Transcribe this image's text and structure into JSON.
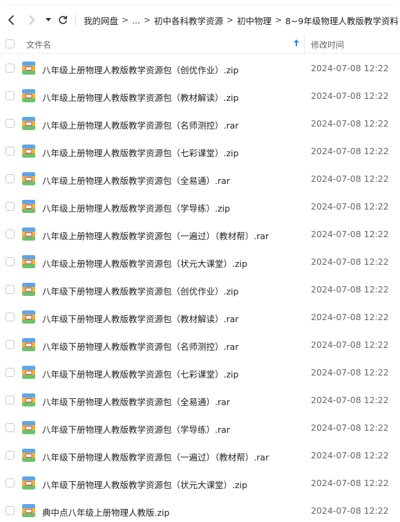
{
  "nav": {
    "back_icon": "chevron-left-icon",
    "forward_icon": "chevron-right-icon",
    "dropdown_icon": "caret-down-icon",
    "refresh_icon": "refresh-icon"
  },
  "breadcrumb": {
    "items": [
      "我的网盘",
      "...",
      "初中各科教学资源",
      "初中物理",
      "8~9年级物理人教版教学资料"
    ],
    "separator": ">"
  },
  "columns": {
    "name": "文件名",
    "modified": "修改时间",
    "sort_icon": "arrow-up-icon"
  },
  "file_icon": "archive-file-icon",
  "files": [
    {
      "name": "八年级上册物理人教版教学资源包（创优作业）.zip",
      "modified": "2024-07-08 12:22"
    },
    {
      "name": "八年级上册物理人教版教学资源包（教材解读）.zip",
      "modified": "2024-07-08 12:22"
    },
    {
      "name": "八年级上册物理人教版教学资源包（名师测控）.rar",
      "modified": "2024-07-08 12:22"
    },
    {
      "name": "八年级上册物理人教版教学资源包（七彩课堂）.zip",
      "modified": "2024-07-08 12:22"
    },
    {
      "name": "八年级上册物理人教版教学资源包（全易通）.rar",
      "modified": "2024-07-08 12:22"
    },
    {
      "name": "八年级上册物理人教版教学资源包（学导练）.zip",
      "modified": "2024-07-08 12:22"
    },
    {
      "name": "八年级上册物理人教版教学资源包（一遍过）（教材帮）.rar",
      "modified": "2024-07-08 12:22"
    },
    {
      "name": "八年级上册物理人教版教学资源包（状元大课堂）.zip",
      "modified": "2024-07-08 12:22"
    },
    {
      "name": "八年级下册物理人教版教学资源包（创优作业）.zip",
      "modified": "2024-07-08 12:22"
    },
    {
      "name": "八年级下册物理人教版教学资源包（教材解读）.rar",
      "modified": "2024-07-08 12:22"
    },
    {
      "name": "八年级下册物理人教版教学资源包（名师测控）.rar",
      "modified": "2024-07-08 12:22"
    },
    {
      "name": "八年级下册物理人教版教学资源包（七彩课堂）.zip",
      "modified": "2024-07-08 12:22"
    },
    {
      "name": "八年级下册物理人教版教学资源包（全易通）.rar",
      "modified": "2024-07-08 12:22"
    },
    {
      "name": "八年级下册物理人教版教学资源包（学导练）.rar",
      "modified": "2024-07-08 12:22"
    },
    {
      "name": "八年级下册物理人教版教学资源包（一遍过）（教材帮）.rar",
      "modified": "2024-07-08 12:22"
    },
    {
      "name": "八年级下册物理人教版教学资源包（状元大课堂）.zip",
      "modified": "2024-07-08 12:22"
    },
    {
      "name": "典中点八年级上册物理人教版.zip",
      "modified": "2024-07-08 12:22"
    }
  ]
}
